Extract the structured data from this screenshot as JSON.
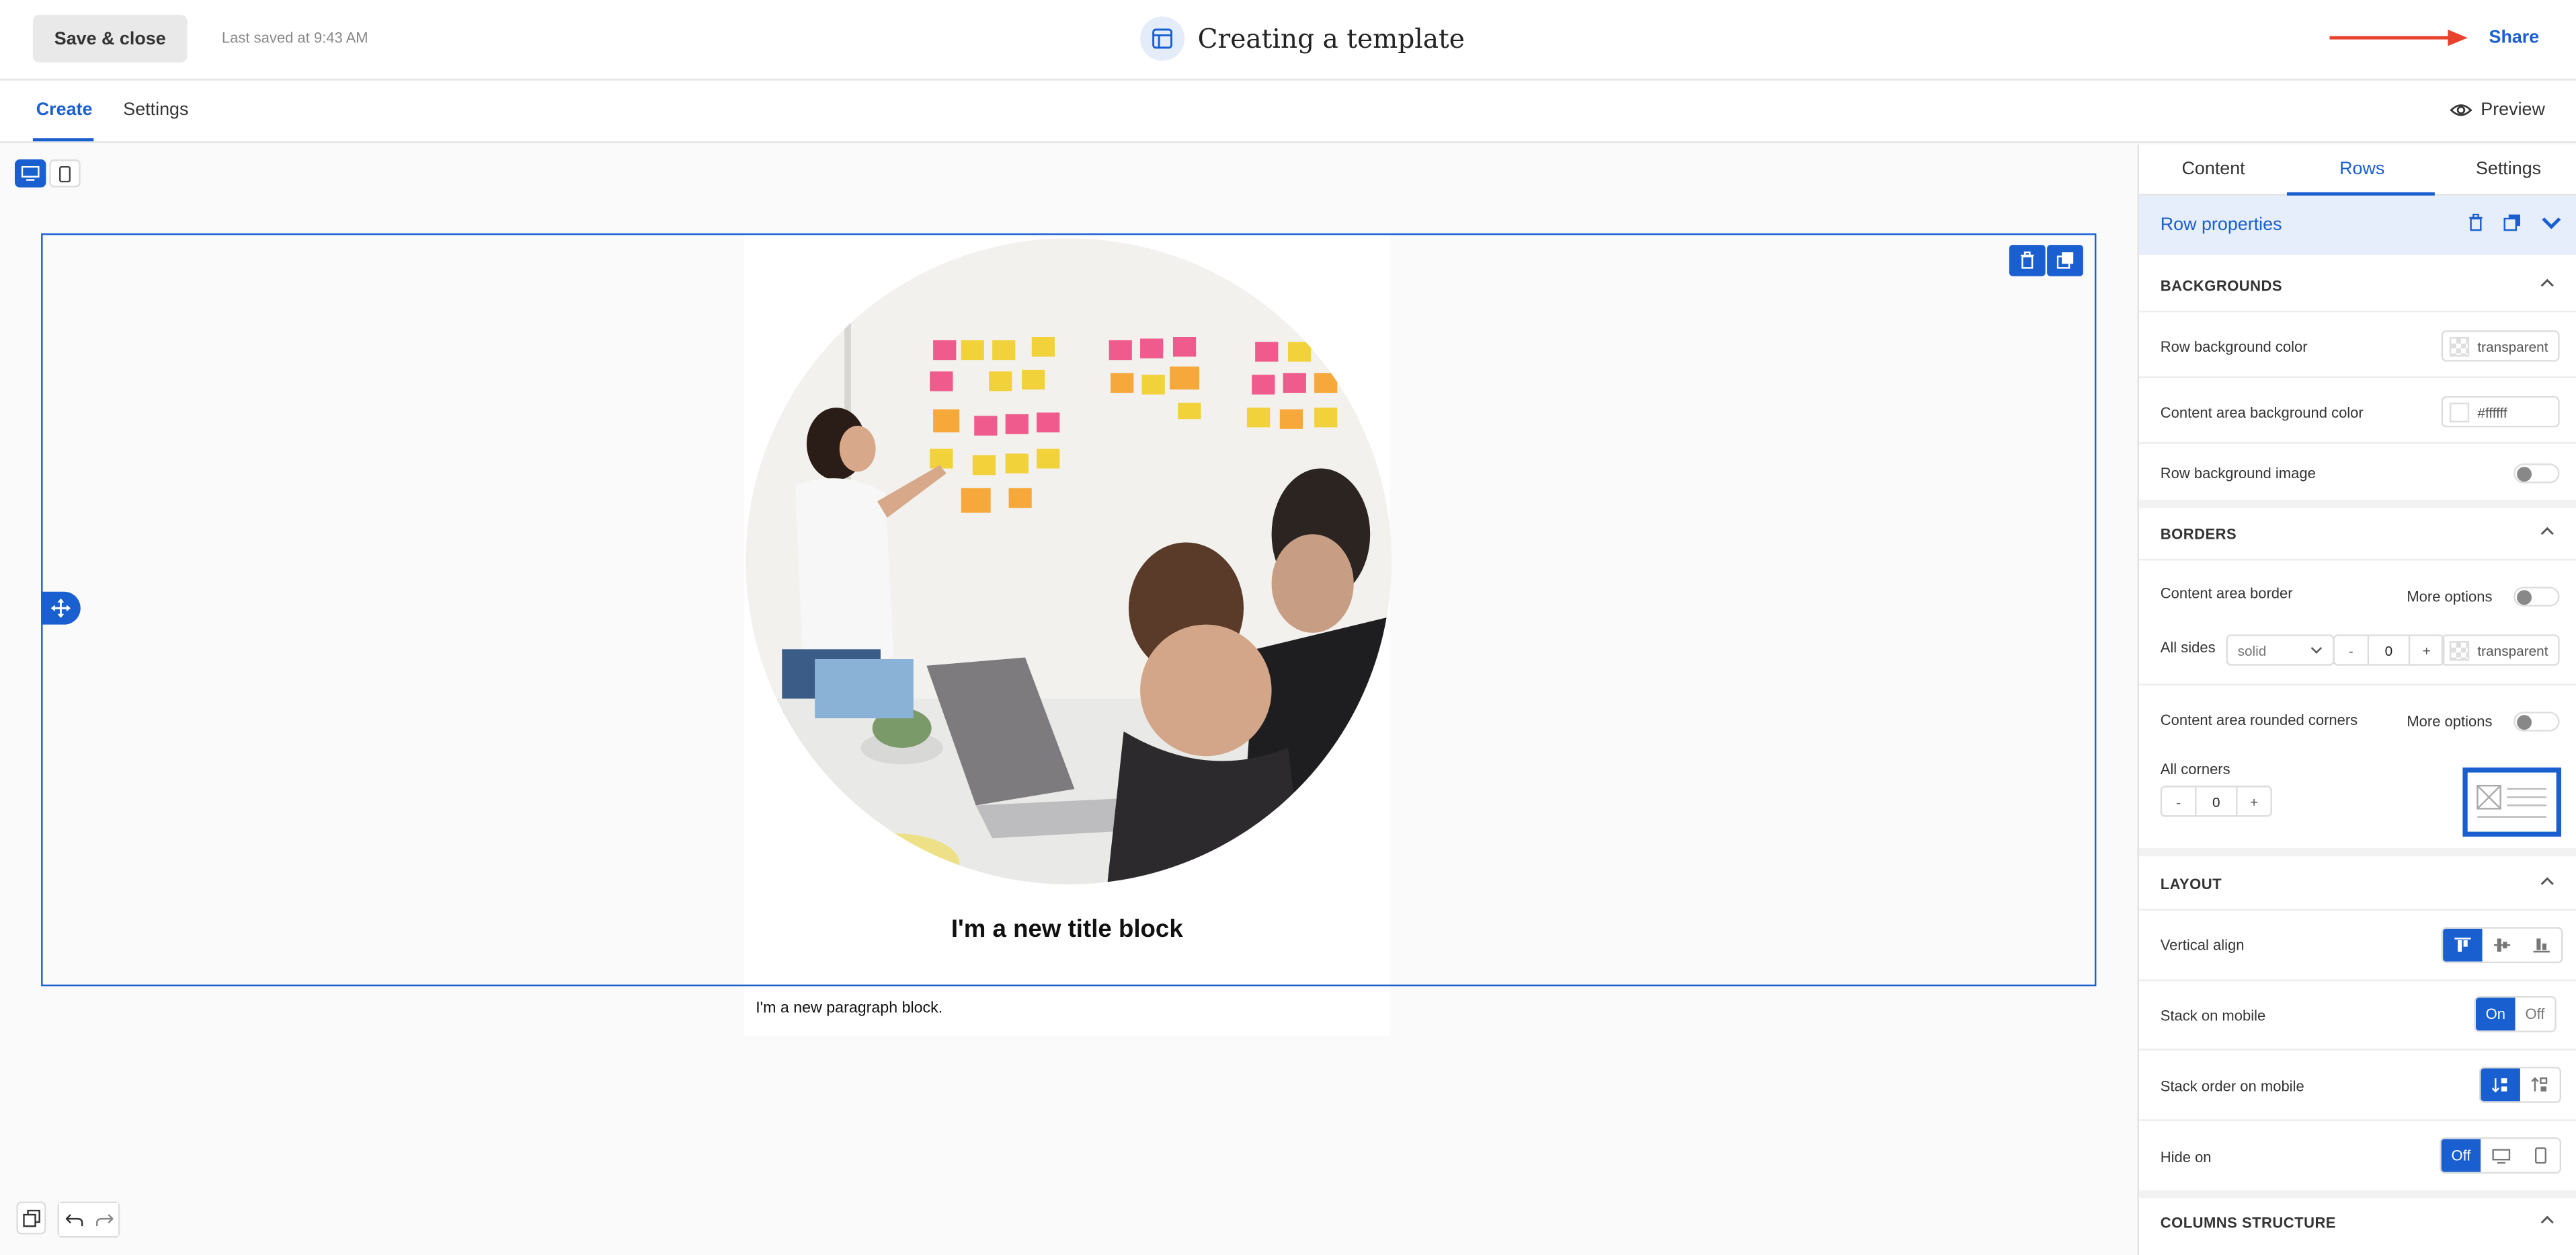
{
  "header": {
    "save_close": "Save & close",
    "last_saved": "Last saved at 9:43 AM",
    "title": "Creating a template",
    "share": "Share"
  },
  "tabs": {
    "create": "Create",
    "settings": "Settings",
    "preview": "Preview"
  },
  "canvas": {
    "title_block": "I'm a new title block",
    "paragraph_block": "I'm a new paragraph block."
  },
  "panel": {
    "tabs": [
      "Content",
      "Rows",
      "Settings"
    ],
    "active_tab": "Rows",
    "row_properties": "Row properties",
    "backgrounds": {
      "heading": "BACKGROUNDS",
      "row_bg_label": "Row background color",
      "row_bg_value": "transparent",
      "content_bg_label": "Content area background color",
      "content_bg_value": "#ffffff",
      "row_bg_image_label": "Row background image"
    },
    "borders": {
      "heading": "BORDERS",
      "content_border_label": "Content area border",
      "more_options": "More options",
      "all_sides_label": "All sides",
      "style_value": "solid",
      "minus": "-",
      "plus": "+",
      "width_value": "0",
      "color_value": "transparent",
      "rounded_label": "Content area rounded corners",
      "all_corners_label": "All corners",
      "corner_value": "0"
    },
    "layout": {
      "heading": "LAYOUT",
      "vertical_align_label": "Vertical align",
      "stack_mobile_label": "Stack on mobile",
      "stack_on": "On",
      "stack_off": "Off",
      "stack_order_label": "Stack order on mobile",
      "hide_on_label": "Hide on",
      "hide_off": "Off"
    },
    "columns_structure": "COLUMNS STRUCTURE"
  },
  "colors": {
    "accent": "#1a5fd0",
    "arrow": "#e8412c"
  }
}
